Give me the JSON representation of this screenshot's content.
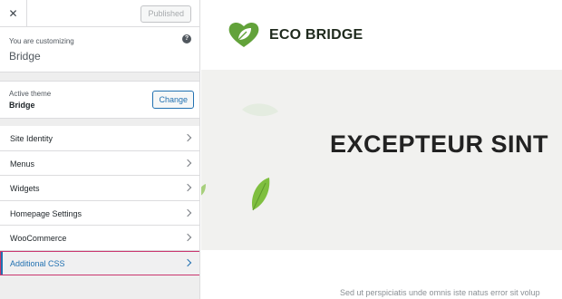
{
  "panel": {
    "close_glyph": "✕",
    "published_label": "Published",
    "customizing_label": "You are customizing",
    "site_name": "Bridge",
    "help_glyph": "?",
    "active_theme_label": "Active theme",
    "theme_name": "Bridge",
    "change_label": "Change",
    "menu_items": [
      {
        "label": "Site Identity"
      },
      {
        "label": "Menus"
      },
      {
        "label": "Widgets"
      },
      {
        "label": "Homepage Settings"
      },
      {
        "label": "WooCommerce"
      },
      {
        "label": "Additional CSS",
        "active": true
      }
    ]
  },
  "preview": {
    "brand": "ECO BRIDGE",
    "hero_title": "EXCEPTEUR SINT",
    "body_text": "Sed ut perspiciatis unde omnis iste natus error sit volup"
  },
  "colors": {
    "accent_blue": "#2271b1",
    "highlight_pink": "#c9356e",
    "brand_green": "#62a23a",
    "leaf_light": "#e4ece0"
  },
  "icons": [
    "close-icon",
    "help-icon",
    "chevron-right-icon",
    "eco-logo-leaf-icon"
  ]
}
